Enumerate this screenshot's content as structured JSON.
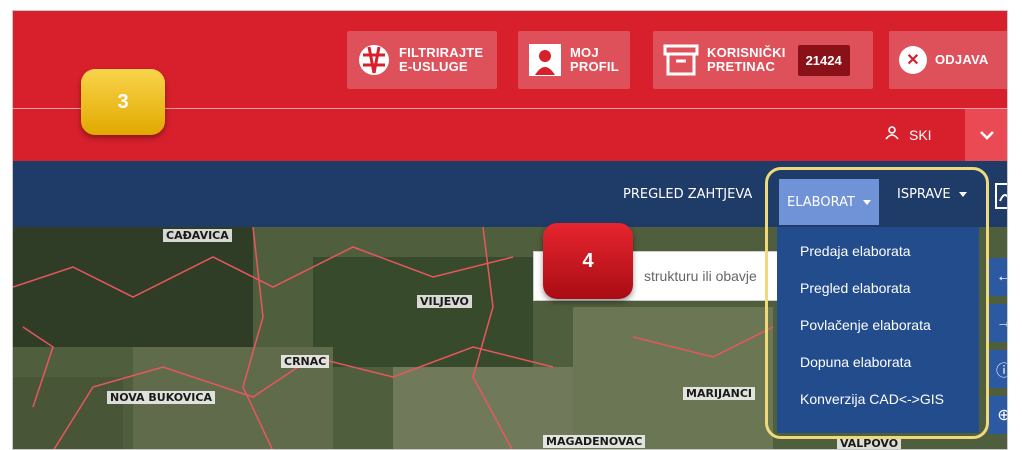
{
  "header": {
    "filter_label": "FILTRIRAJTE\nE-USLUGE",
    "profile_label": "MOJ\nPROFIL",
    "inbox_label": "KORISNIČKI\nPRETINAC",
    "inbox_count": "21424",
    "logout_label": "ODJAVA",
    "user_name": "SKI"
  },
  "nav": {
    "review_requests": "PREGLED ZAHTJEVA",
    "elaborat": "ELABORAT",
    "isprave": "ISPRAVE"
  },
  "dropdown": {
    "items": [
      "Predaja elaborata",
      "Pregled elaborata",
      "Povlačenje elaborata",
      "Dopuna elaborata",
      "Konverzija CAD<->GIS"
    ]
  },
  "search": {
    "visible_text": "strukturu ili obavje"
  },
  "map": {
    "labels": [
      "CAĐAVICA",
      "VILJEVO",
      "CRNAC",
      "NOVA BUKOVICA",
      "MARIJANCI",
      "MAGADENOVAC",
      "VALPOVO"
    ]
  },
  "steps": {
    "step_a": "3",
    "step_b": "4"
  },
  "colors": {
    "header_red": "#d7202c",
    "nav_navy": "#1f3b68",
    "dropdown_blue": "#234c8c",
    "active_tab": "#6f93d6",
    "highlight": "#efd97a"
  }
}
